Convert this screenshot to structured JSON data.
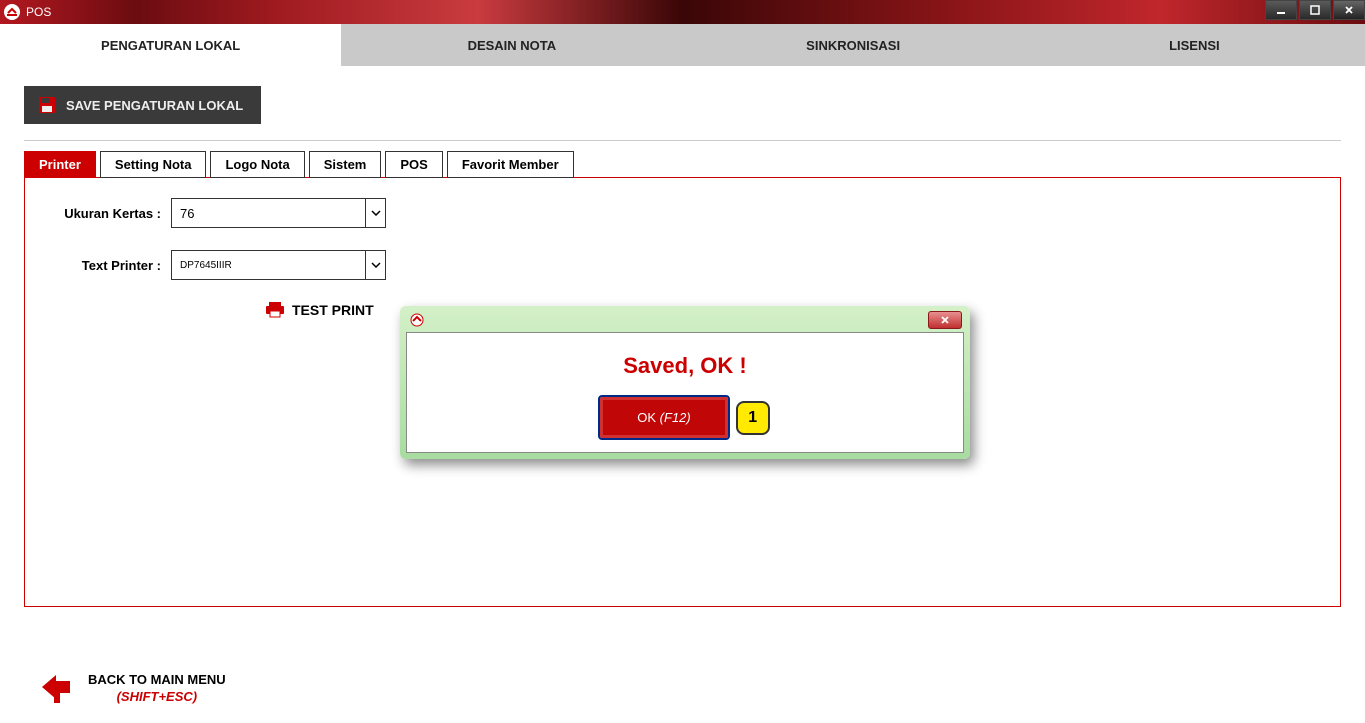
{
  "window": {
    "title": "POS"
  },
  "main_tabs": [
    "PENGATURAN LOKAL",
    "DESAIN NOTA",
    "SINKRONISASI",
    "LISENSI"
  ],
  "save_button_label": "SAVE PENGATURAN LOKAL",
  "sub_tabs": [
    "Printer",
    "Setting Nota",
    "Logo Nota",
    "Sistem",
    "POS",
    "Favorit Member"
  ],
  "form": {
    "ukuran_label": "Ukuran Kertas :",
    "ukuran_value": "76",
    "printer_label": "Text Printer :",
    "printer_value": "DP7645IIIR",
    "test_print_label": "TEST PRINT"
  },
  "footer": {
    "main": "BACK TO MAIN MENU",
    "shortcut": "(SHIFT+ESC)"
  },
  "modal": {
    "message": "Saved, OK !",
    "ok_label": "OK",
    "ok_shortcut": "(F12)",
    "badge": "1"
  }
}
